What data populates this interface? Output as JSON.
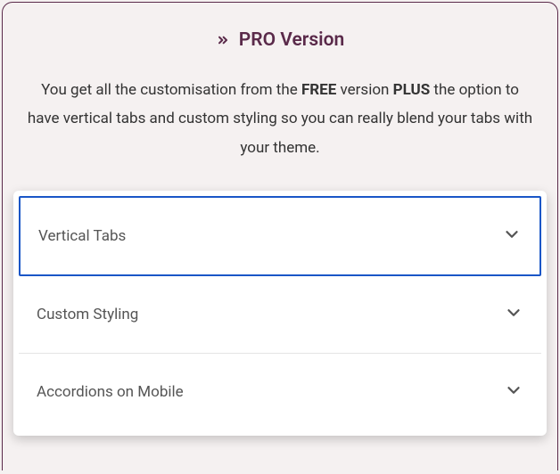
{
  "header": {
    "title": "PRO Version"
  },
  "description": {
    "part1": "You get all the customisation from the ",
    "bold1": "FREE",
    "part2": " version ",
    "bold2": "PLUS",
    "part3": " the option to have vertical tabs and custom styling so you can really blend your tabs with your theme."
  },
  "accordion": {
    "items": [
      {
        "label": "Vertical Tabs",
        "active": true
      },
      {
        "label": "Custom Styling",
        "active": false
      },
      {
        "label": "Accordions on Mobile",
        "active": false
      }
    ]
  }
}
